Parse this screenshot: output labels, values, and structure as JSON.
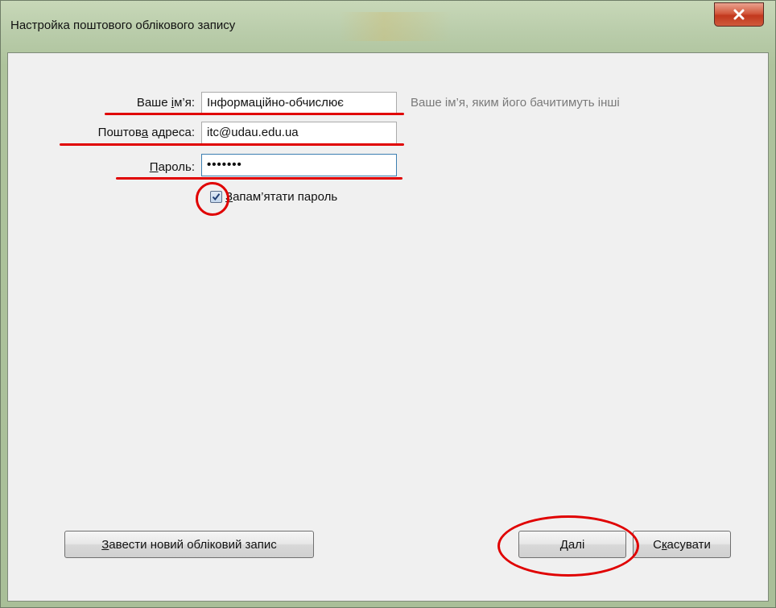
{
  "window": {
    "title": "Настройка поштового облікового запису"
  },
  "form": {
    "name": {
      "label_before": "Ваше ",
      "label_key": "і",
      "label_after": "м’я:",
      "value": "Інформаційно-обчислює",
      "hint": "Ваше ім’я, яким його бачитимуть інші"
    },
    "email": {
      "label_before": "Поштов",
      "label_key": "а",
      "label_after": " адреса:",
      "value": "itc@udau.edu.ua"
    },
    "password": {
      "label_before": "",
      "label_key": "П",
      "label_after": "ароль:",
      "value": "•••••••"
    },
    "remember": {
      "checked": true,
      "label_key": "З",
      "label_after": "апам’ятати пароль"
    }
  },
  "buttons": {
    "new_account": {
      "label_key": "З",
      "label_after": "авести новий обліковий запис"
    },
    "next": {
      "label_key": "Д",
      "label_after": "алі"
    },
    "cancel": {
      "label_before": "С",
      "label_key": "к",
      "label_after": "асувати"
    }
  },
  "colors": {
    "annotation": "#e00000",
    "close_button": "#c2381d",
    "frame": "#b9ccaa"
  },
  "icons": {
    "close": "close-icon",
    "checkbox": "checkmark-icon"
  }
}
